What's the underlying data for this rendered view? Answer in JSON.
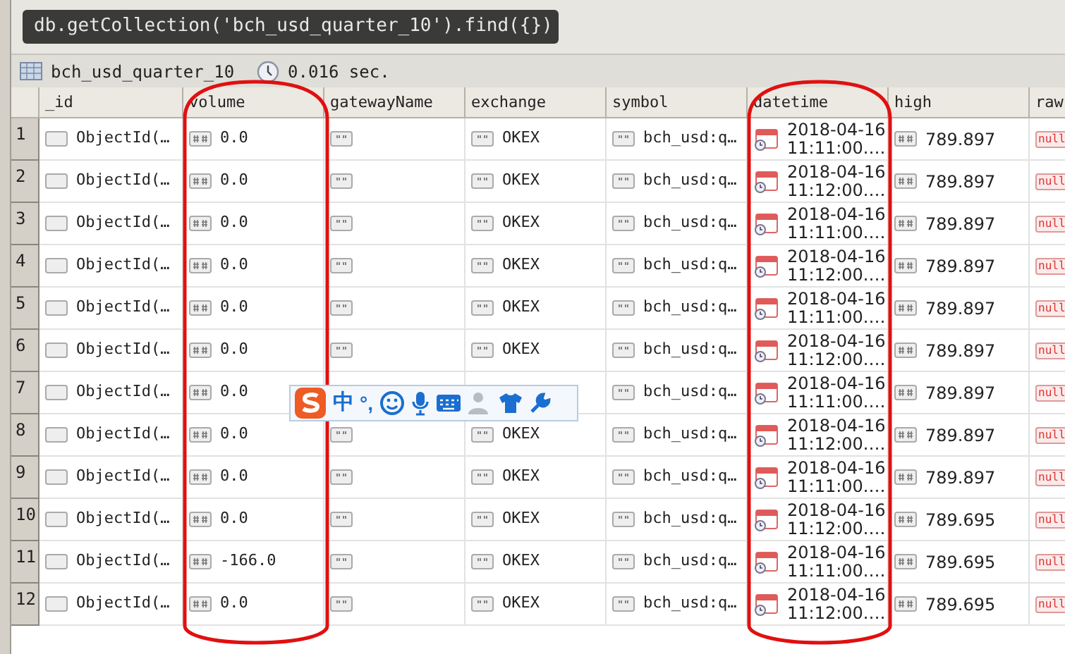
{
  "query": "db.getCollection('bch_usd_quarter_10').find({})",
  "result": {
    "collection": "bch_usd_quarter_10",
    "elapsed": "0.016 sec."
  },
  "table": {
    "columns": [
      "_id",
      "volume",
      "gatewayName",
      "exchange",
      "symbol",
      "datetime",
      "high",
      "raw"
    ],
    "rows": [
      {
        "num": "1",
        "id": "ObjectId(…",
        "volume": "0.0",
        "exchange": "OKEX",
        "symbol": "bch_usd:q…",
        "date": "2018-04-16",
        "time": "11:11:00.…",
        "high": "789.897",
        "raw": "null"
      },
      {
        "num": "2",
        "id": "ObjectId(…",
        "volume": "0.0",
        "exchange": "OKEX",
        "symbol": "bch_usd:q…",
        "date": "2018-04-16",
        "time": "11:12:00.…",
        "high": "789.897",
        "raw": "null"
      },
      {
        "num": "3",
        "id": "ObjectId(…",
        "volume": "0.0",
        "exchange": "OKEX",
        "symbol": "bch_usd:q…",
        "date": "2018-04-16",
        "time": "11:11:00.…",
        "high": "789.897",
        "raw": "null"
      },
      {
        "num": "4",
        "id": "ObjectId(…",
        "volume": "0.0",
        "exchange": "OKEX",
        "symbol": "bch_usd:q…",
        "date": "2018-04-16",
        "time": "11:12:00.…",
        "high": "789.897",
        "raw": "null"
      },
      {
        "num": "5",
        "id": "ObjectId(…",
        "volume": "0.0",
        "exchange": "OKEX",
        "symbol": "bch_usd:q…",
        "date": "2018-04-16",
        "time": "11:11:00.…",
        "high": "789.897",
        "raw": "null"
      },
      {
        "num": "6",
        "id": "ObjectId(…",
        "volume": "0.0",
        "exchange": "OKEX",
        "symbol": "bch_usd:q…",
        "date": "2018-04-16",
        "time": "11:12:00.…",
        "high": "789.897",
        "raw": "null"
      },
      {
        "num": "7",
        "id": "ObjectId(…",
        "volume": "0.0",
        "symbol": "bch_usd:q…",
        "date": "2018-04-16",
        "time": "11:11:00.…",
        "high": "789.897",
        "raw": "null"
      },
      {
        "num": "8",
        "id": "ObjectId(…",
        "volume": "0.0",
        "exchange": "OKEX",
        "symbol": "bch_usd:q…",
        "date": "2018-04-16",
        "time": "11:12:00.…",
        "high": "789.897",
        "raw": "null"
      },
      {
        "num": "9",
        "id": "ObjectId(…",
        "volume": "0.0",
        "exchange": "OKEX",
        "symbol": "bch_usd:q…",
        "date": "2018-04-16",
        "time": "11:11:00.…",
        "high": "789.897",
        "raw": "null"
      },
      {
        "num": "10",
        "id": "ObjectId(…",
        "volume": "0.0",
        "exchange": "OKEX",
        "symbol": "bch_usd:q…",
        "date": "2018-04-16",
        "time": "11:12:00.…",
        "high": "789.695",
        "raw": "null"
      },
      {
        "num": "11",
        "id": "ObjectId(…",
        "volume": "-166.0",
        "exchange": "OKEX",
        "symbol": "bch_usd:q…",
        "date": "2018-04-16",
        "time": "11:11:00.…",
        "high": "789.695",
        "raw": "null"
      },
      {
        "num": "12",
        "id": "ObjectId(…",
        "volume": "0.0",
        "exchange": "OKEX",
        "symbol": "bch_usd:q…",
        "date": "2018-04-16",
        "time": "11:12:00.…",
        "high": "789.695",
        "raw": "null"
      }
    ]
  },
  "ime_toolbar": {
    "language": "中",
    "punctuation": "°,"
  }
}
